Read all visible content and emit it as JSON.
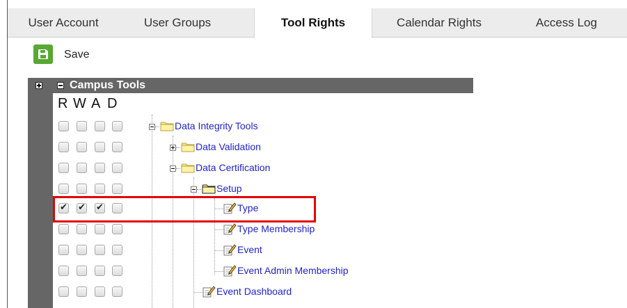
{
  "tabs": [
    {
      "label": "User Account",
      "active": false
    },
    {
      "label": "User Groups",
      "active": false
    },
    {
      "label": "Tool Rights",
      "active": true
    },
    {
      "label": "Calendar Rights",
      "active": false
    },
    {
      "label": "Access Log",
      "active": false
    }
  ],
  "toolbar": {
    "save_label": "Save"
  },
  "category": {
    "title": "Campus Tools"
  },
  "rights_headers": [
    "R",
    "W",
    "A",
    "D"
  ],
  "rows": [
    {
      "label": "Data Integrity Tools",
      "icon": "folder-icon",
      "checks": [
        false,
        false,
        false,
        false
      ]
    },
    {
      "label": "Data Validation",
      "icon": "folder-icon",
      "checks": [
        false,
        false,
        false,
        false
      ]
    },
    {
      "label": "Data Certification",
      "icon": "folder-icon",
      "checks": [
        false,
        false,
        false,
        false
      ]
    },
    {
      "label": "Setup",
      "icon": "folder-open-icon",
      "checks": [
        false,
        false,
        false,
        false
      ]
    },
    {
      "label": "Type",
      "icon": "tool-page-icon",
      "checks": [
        true,
        true,
        true,
        false
      ]
    },
    {
      "label": "Type Membership",
      "icon": "tool-page-icon",
      "checks": [
        false,
        false,
        false,
        false
      ]
    },
    {
      "label": "Event",
      "icon": "tool-page-icon",
      "checks": [
        false,
        false,
        false,
        false
      ]
    },
    {
      "label": "Event Admin Membership",
      "icon": "tool-page-icon",
      "checks": [
        false,
        false,
        false,
        false
      ]
    },
    {
      "label": "Event Dashboard",
      "icon": "tool-page-icon",
      "checks": [
        false,
        false,
        false,
        false
      ]
    }
  ],
  "colors": {
    "accent_green": "#58a832",
    "link_blue": "#2222cc",
    "header_gray": "#666666",
    "highlight_red": "#e30000"
  }
}
